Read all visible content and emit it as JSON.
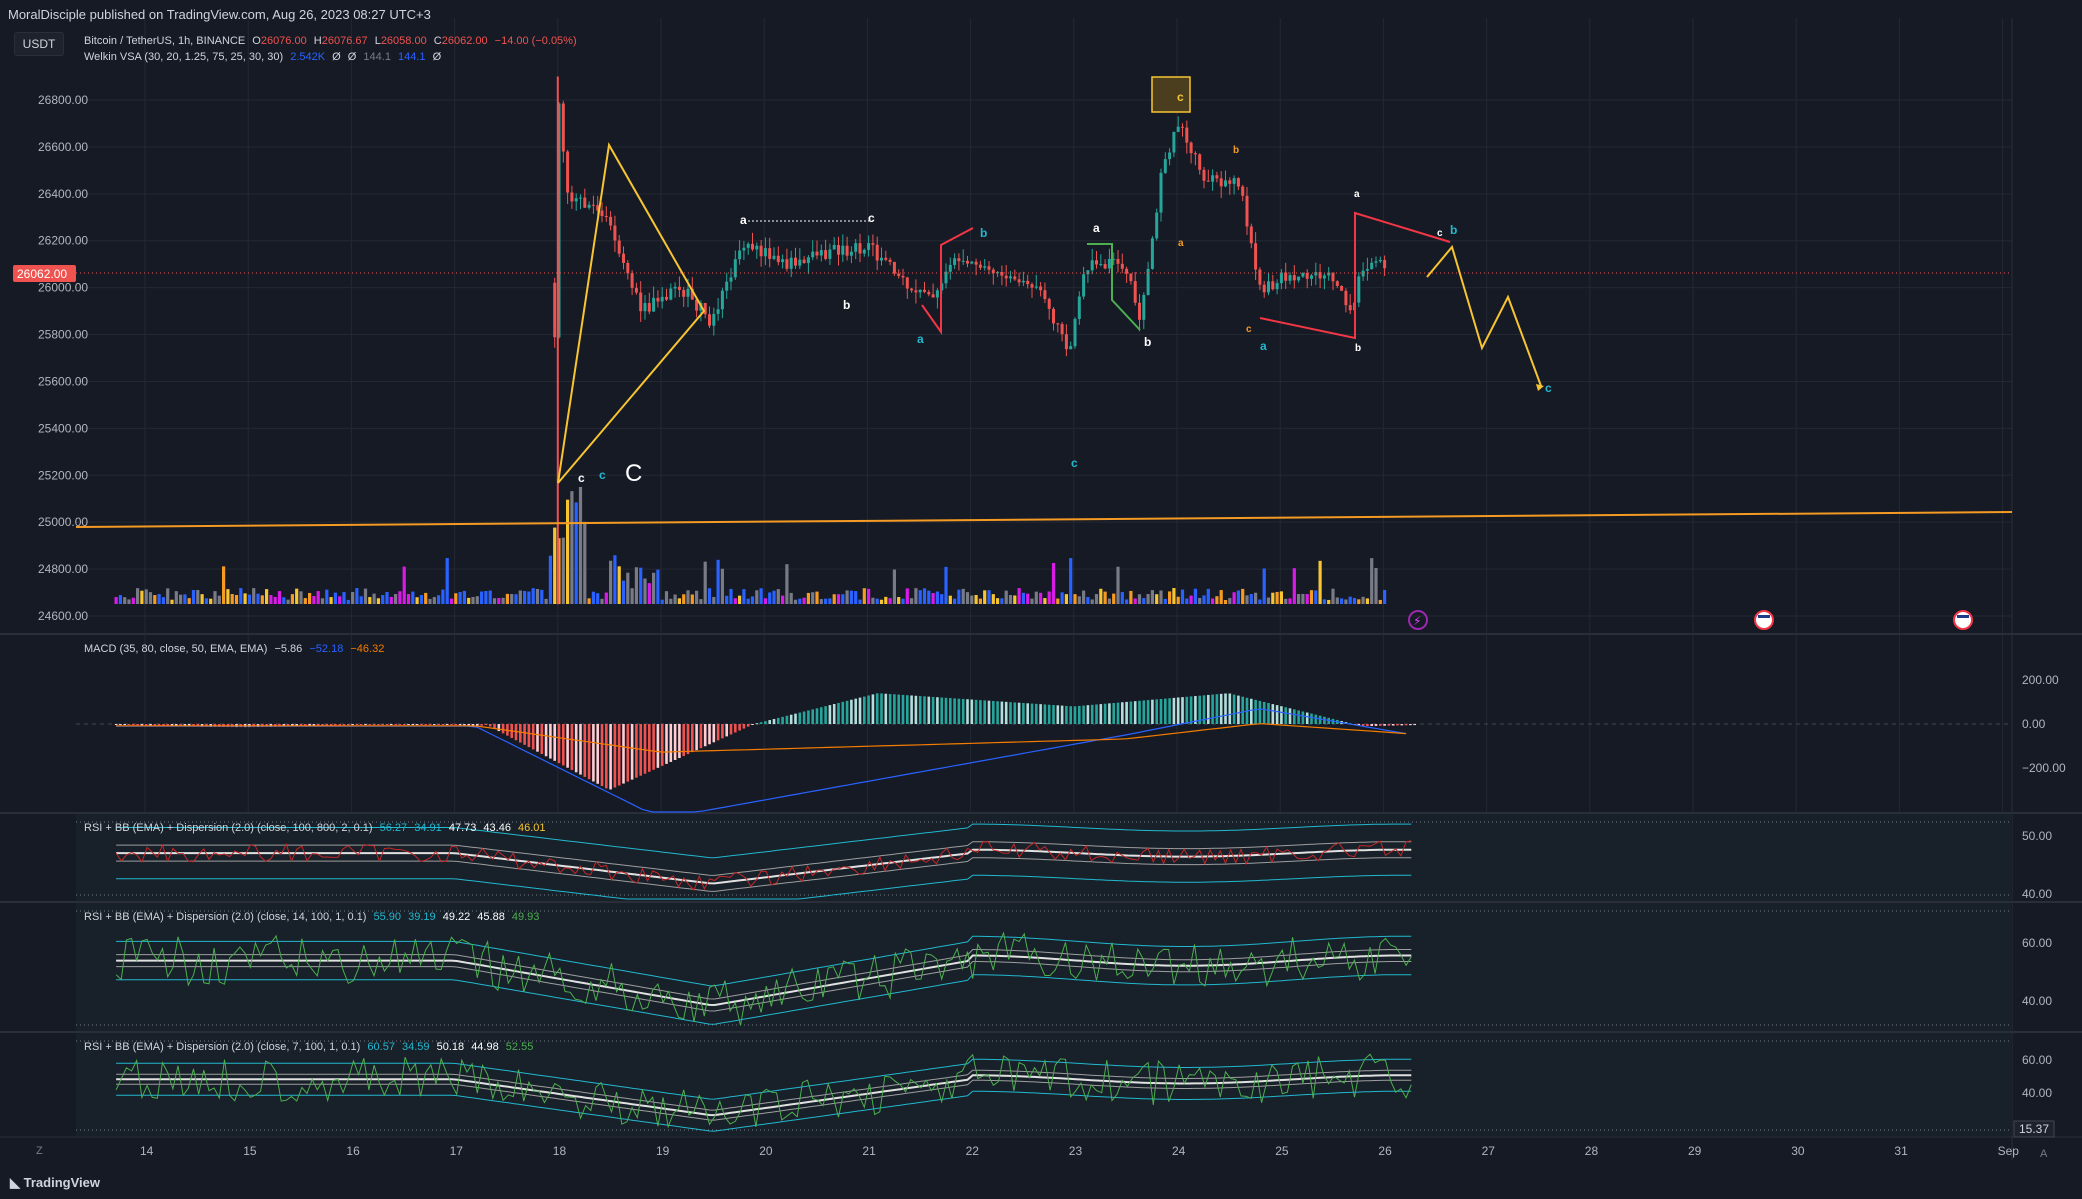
{
  "header": {
    "published": "MoralDisciple published on TradingView.com, Aug 26, 2023 08:27 UTC+3",
    "currency_button": "USDT"
  },
  "main_legend": {
    "symbol": "Bitcoin / TetherUS, 1h, BINANCE",
    "o_label": "O",
    "o_value": "26076.00",
    "h_label": "H",
    "h_value": "26076.67",
    "l_label": "L",
    "l_value": "26058.00",
    "c_label": "C",
    "c_value": "26062.00",
    "change": "−14.00 (−0.05%)"
  },
  "vsa_legend": {
    "name": "Welkin VSA (30, 20, 1.25, 75, 25, 30, 30)",
    "v1": "2.542K",
    "v2": "Ø",
    "v3": "Ø",
    "v4": "144.1",
    "v5": "144.1",
    "v6": "Ø"
  },
  "macd_legend": {
    "name": "MACD (35, 80, close, 50, EMA, EMA)",
    "hist": "−5.86",
    "macd": "−52.18",
    "signal": "−46.32"
  },
  "rsi1_legend": {
    "name": "RSI + BB (EMA) + Dispersion (2.0) (close, 100, 800, 2, 0.1)",
    "values": [
      "56.27",
      "34.91",
      "47.73",
      "43.46",
      "46.01"
    ]
  },
  "rsi2_legend": {
    "name": "RSI + BB (EMA) + Dispersion (2.0) (close, 14, 100, 1, 0.1)",
    "values": [
      "55.90",
      "39.19",
      "49.22",
      "45.88",
      "49.93"
    ]
  },
  "rsi3_legend": {
    "name": "RSI + BB (EMA) + Dispersion (2.0) (close, 7, 100, 1, 0.1)",
    "values": [
      "60.57",
      "34.59",
      "50.18",
      "44.98",
      "52.55"
    ]
  },
  "price_axis": {
    "ticks": [
      "26800.00",
      "26600.00",
      "26400.00",
      "26200.00",
      "26000.00",
      "25800.00",
      "25600.00",
      "25400.00",
      "25200.00",
      "25000.00",
      "24800.00",
      "24600.00"
    ],
    "current_price": "26062.00"
  },
  "macd_axis": {
    "ticks": [
      "200.00",
      "0.00",
      "−200.00"
    ]
  },
  "rsi1_axis": {
    "ticks": [
      "50.00",
      "40.00"
    ]
  },
  "rsi2_axis": {
    "ticks": [
      "60.00",
      "40.00"
    ]
  },
  "rsi3_axis": {
    "ticks": [
      "60.00",
      "40.00"
    ],
    "current": "15.37"
  },
  "time_axis": {
    "ticks": [
      "14",
      "15",
      "16",
      "17",
      "18",
      "19",
      "20",
      "21",
      "22",
      "23",
      "24",
      "25",
      "26",
      "27",
      "28",
      "29",
      "30",
      "31",
      "Sep"
    ]
  },
  "wave_labels": {
    "c_small_1": "c",
    "c_cyan_1": "c",
    "C_big": "C",
    "a_1": "a",
    "c_2": "c",
    "b_1": "b",
    "a_cyan_1": "a",
    "b_cyan_1": "b",
    "c_cyan_2": "c",
    "a_2": "a",
    "b_2": "b",
    "c_boxed": "c",
    "b_orange": "b",
    "a_orange": "a",
    "c_3": "c",
    "a_cyan_2": "a",
    "a_3": "a",
    "b_3": "b",
    "c_4": "c",
    "b_cyan_2": "b",
    "c_cyan_3": "c"
  },
  "footer": {
    "logo": "TradingView",
    "zoom": "Z",
    "axis_corner": "A"
  },
  "colors": {
    "background": "#161a25",
    "grid": "#242833",
    "up": "#26a69a",
    "down": "#ef5350",
    "pattern_yellow": "#f7c531",
    "trend_orange": "#f59a23",
    "pattern_red": "#f23645",
    "pattern_green": "#4caf50",
    "cyan": "#22b8cf",
    "macd_line": "#2962ff",
    "signal_line": "#f57c00"
  },
  "chart_data": [
    {
      "type": "candlestick",
      "title": "Bitcoin / TetherUS, 1h, BINANCE",
      "x": [
        "14",
        "15",
        "16",
        "17",
        "18",
        "19",
        "20",
        "21",
        "22",
        "23",
        "24",
        "25",
        "26"
      ],
      "ylim": [
        24600,
        26900
      ],
      "approx_path": [
        [
          17.95,
          25100
        ],
        [
          18.0,
          26850
        ],
        [
          18.1,
          26400
        ],
        [
          18.5,
          26300
        ],
        [
          18.8,
          25900
        ],
        [
          19.2,
          26000
        ],
        [
          19.5,
          25850
        ],
        [
          19.8,
          26200
        ],
        [
          20.2,
          26100
        ],
        [
          20.6,
          26150
        ],
        [
          21.0,
          26180
        ],
        [
          21.3,
          26050
        ],
        [
          21.6,
          25950
        ],
        [
          21.9,
          26150
        ],
        [
          22.3,
          26050
        ],
        [
          22.7,
          26000
        ],
        [
          22.95,
          25700
        ],
        [
          23.1,
          26100
        ],
        [
          23.5,
          26100
        ],
        [
          23.65,
          25850
        ],
        [
          23.85,
          26500
        ],
        [
          24.0,
          26700
        ],
        [
          24.3,
          26450
        ],
        [
          24.6,
          26450
        ],
        [
          24.8,
          26000
        ],
        [
          25.1,
          26050
        ],
        [
          25.5,
          26050
        ],
        [
          25.7,
          25900
        ],
        [
          25.8,
          26100
        ],
        [
          26.1,
          26100
        ],
        [
          26.3,
          26062
        ]
      ],
      "current_price": 26062.0
    },
    {
      "type": "bar",
      "title": "Welkin VSA (30, 20, 1.25, 75, 25, 30, 30)",
      "value": 2542
    },
    {
      "type": "bar",
      "title": "MACD (35, 80, close, 50, EMA, EMA)",
      "series": [
        {
          "name": "Histogram",
          "value": -5.86
        },
        {
          "name": "MACD",
          "value": -52.18
        },
        {
          "name": "Signal",
          "value": -46.32
        }
      ],
      "ylim": [
        -400,
        250
      ]
    },
    {
      "type": "line",
      "title": "RSI + BB (EMA) + Dispersion (2.0) (close, 100, 800, 2, 0.1)",
      "values": [
        56.27,
        34.91,
        47.73,
        43.46,
        46.01
      ]
    },
    {
      "type": "line",
      "title": "RSI + BB (EMA) + Dispersion (2.0) (close, 14, 100, 1, 0.1)",
      "values": [
        55.9,
        39.19,
        49.22,
        45.88,
        49.93
      ]
    },
    {
      "type": "line",
      "title": "RSI + BB (EMA) + Dispersion (2.0) (close, 7, 100, 1, 0.1)",
      "values": [
        60.57,
        34.59,
        50.18,
        44.98,
        52.55
      ]
    }
  ]
}
